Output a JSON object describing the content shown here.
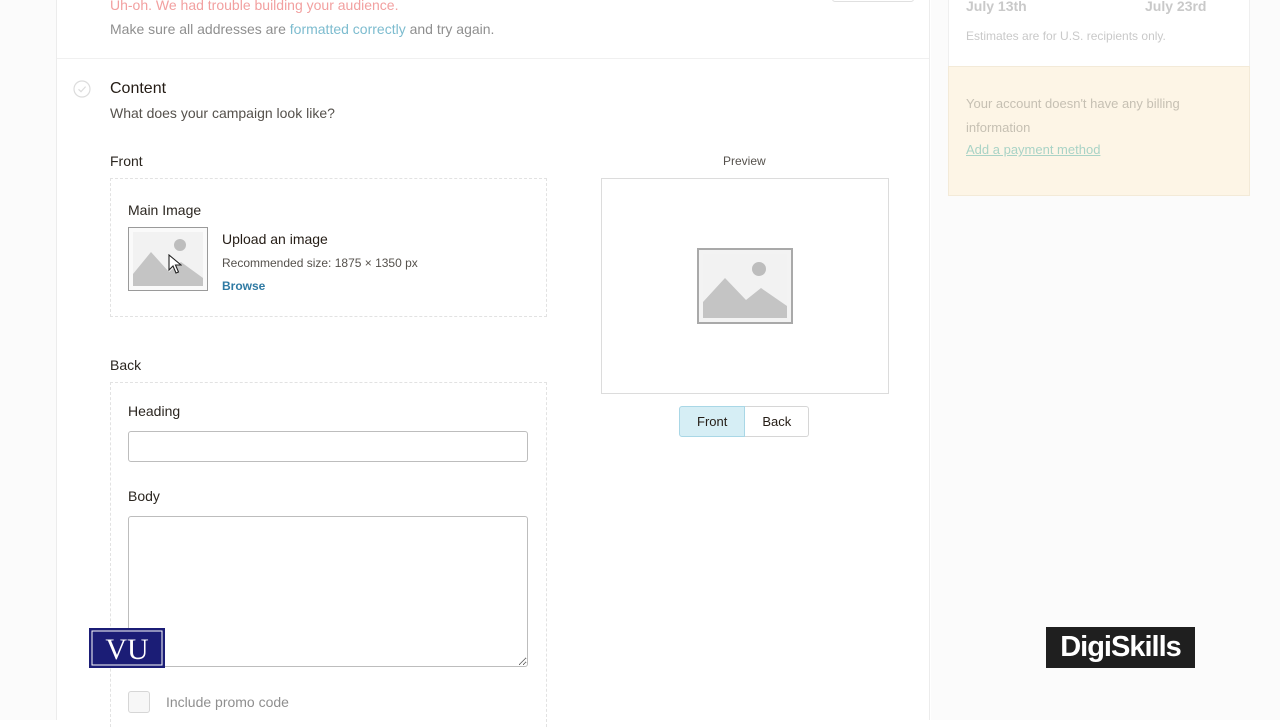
{
  "alert": {
    "error_text": "Uh-oh. We had trouble building your audience.",
    "hint_prefix": "Make sure all addresses are ",
    "hint_link": "formatted correctly",
    "hint_suffix": " and try again."
  },
  "content_section": {
    "title": "Content",
    "subtitle": "What does your campaign look like?"
  },
  "front": {
    "label": "Front",
    "main_image_label": "Main Image",
    "upload_title": "Upload an image",
    "recommended": "Recommended size: 1875 × 1350 px",
    "browse_label": "Browse"
  },
  "back": {
    "label": "Back",
    "heading_label": "Heading",
    "heading_value": "",
    "body_label": "Body",
    "body_value": "",
    "promo_label": "Include promo code"
  },
  "preview": {
    "label": "Preview",
    "front_button": "Front",
    "back_button": "Back",
    "active": "Front"
  },
  "sidebar": {
    "date_start": "July 13th",
    "date_end": "July 23rd",
    "estimate_note": "Estimates are for U.S. recipients only.",
    "billing_text": "Your account doesn't have any billing information",
    "billing_link": "Add a payment method"
  },
  "watermarks": {
    "left_logo_text": "VU",
    "right_logo_text": "DigiSkills"
  },
  "colors": {
    "error": "#f2a0a0",
    "link": "#2f7aa3",
    "toggle_active": "#d6eef5",
    "billing_bg": "#fdf5e6"
  }
}
